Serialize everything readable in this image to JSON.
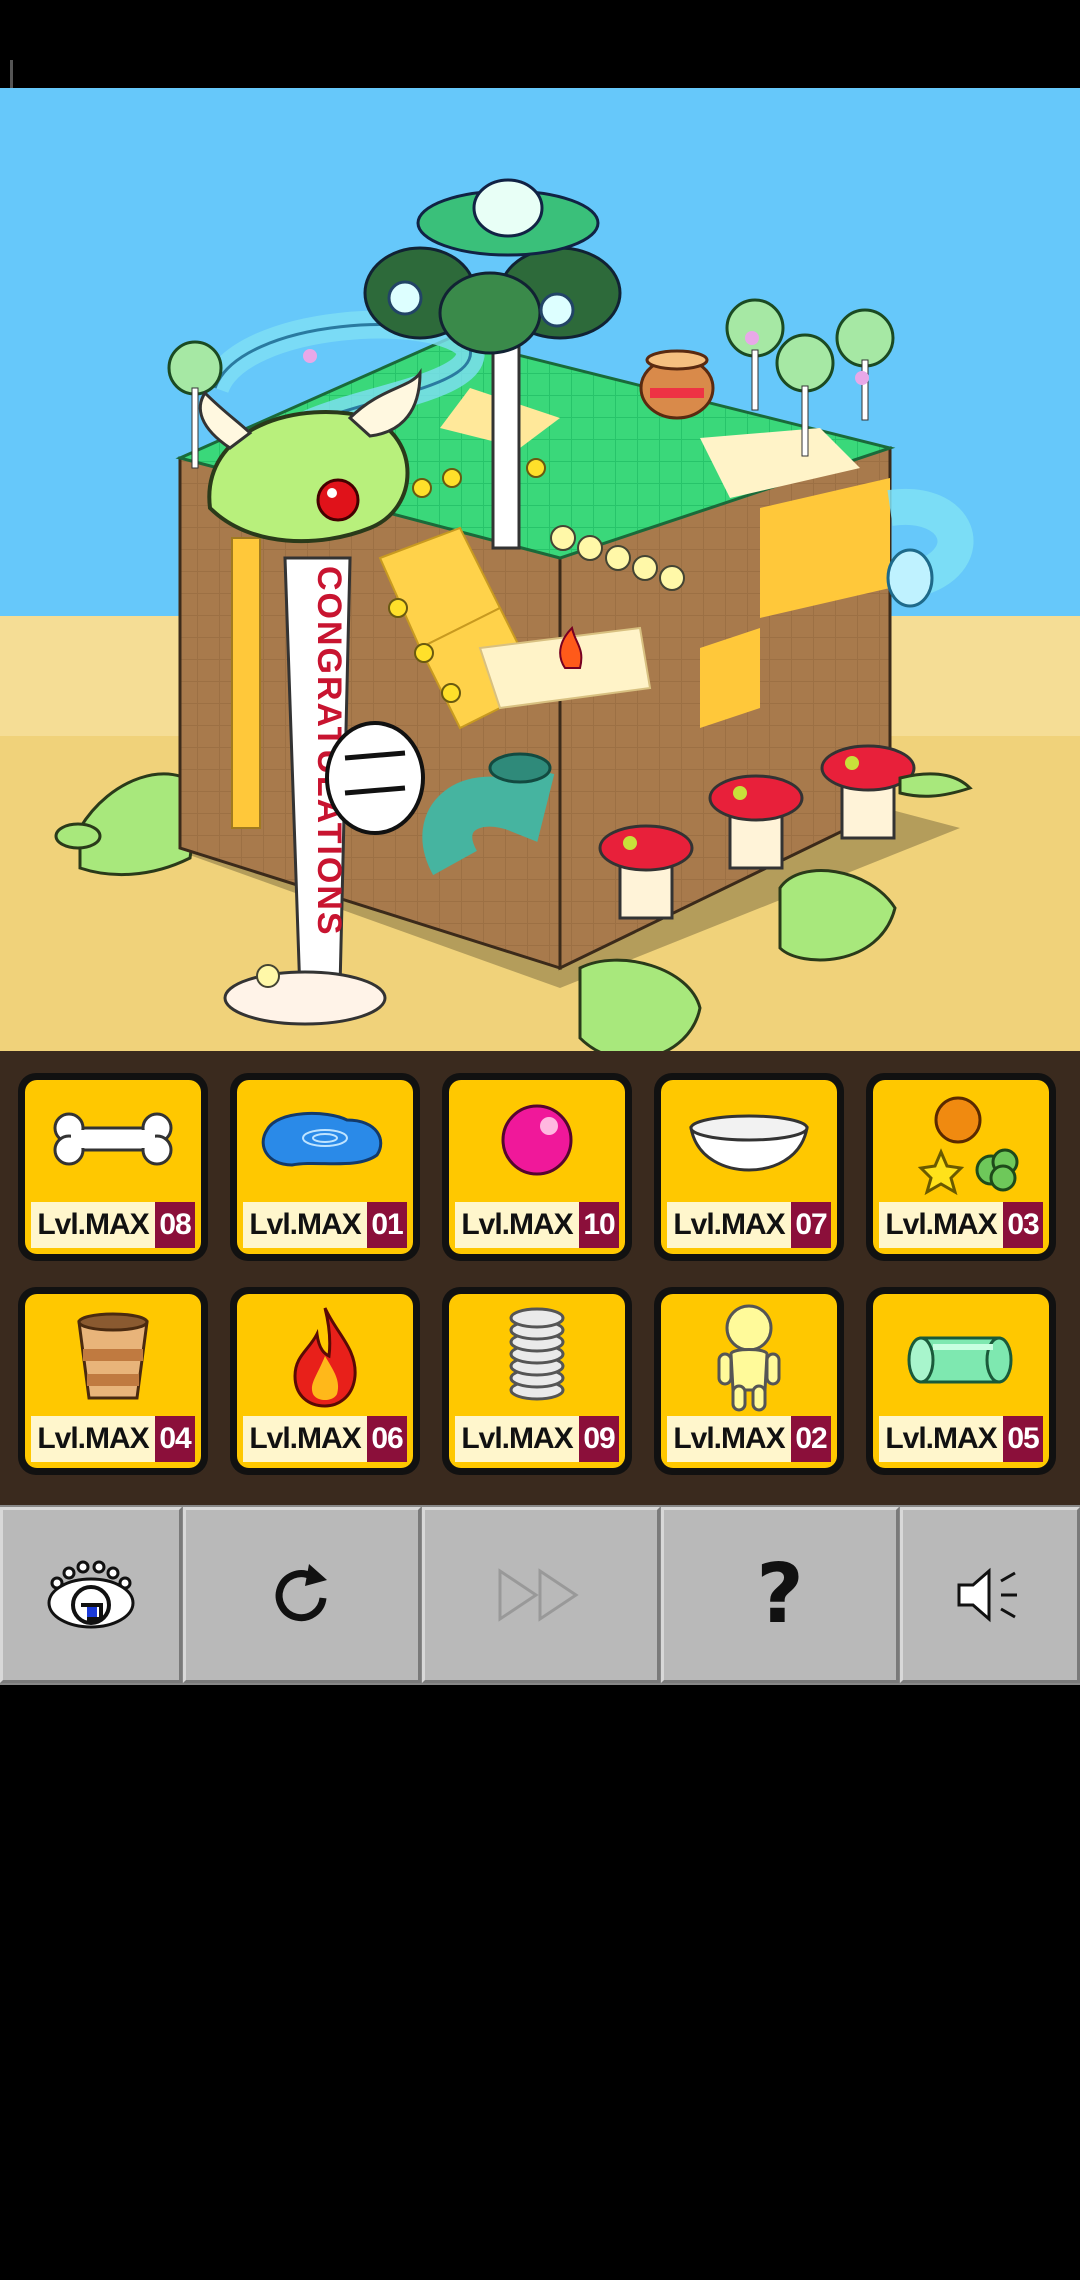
{
  "game": {
    "scene_banner_text": "CONGRATULATIONS",
    "items": [
      {
        "icon": "bone-icon",
        "level": "Lvl.MAX",
        "number": "08"
      },
      {
        "icon": "water-puddle-icon",
        "level": "Lvl.MAX",
        "number": "01"
      },
      {
        "icon": "pink-ball-icon",
        "level": "Lvl.MAX",
        "number": "10"
      },
      {
        "icon": "white-bowl-icon",
        "level": "Lvl.MAX",
        "number": "07"
      },
      {
        "icon": "fruits-icon",
        "level": "Lvl.MAX",
        "number": "03"
      },
      {
        "icon": "wooden-bucket-icon",
        "level": "Lvl.MAX",
        "number": "04"
      },
      {
        "icon": "fire-icon",
        "level": "Lvl.MAX",
        "number": "06"
      },
      {
        "icon": "spring-icon",
        "level": "Lvl.MAX",
        "number": "09"
      },
      {
        "icon": "little-person-icon",
        "level": "Lvl.MAX",
        "number": "02"
      },
      {
        "icon": "glass-tube-icon",
        "level": "Lvl.MAX",
        "number": "05"
      }
    ],
    "toolbar": [
      {
        "icon": "eye-logo-icon",
        "enabled": true
      },
      {
        "icon": "restart-icon",
        "enabled": true
      },
      {
        "icon": "fast-forward-icon",
        "enabled": false
      },
      {
        "icon": "help-question-icon",
        "label": "?",
        "enabled": true
      },
      {
        "icon": "speaker-icon",
        "enabled": true
      }
    ]
  },
  "colors": {
    "sky": "#66c8fa",
    "sand": "#f0d27a",
    "tray": "#3a2a1e",
    "card": "#ffc800",
    "number_badge": "#8b0f3a",
    "toolbar_button": "#b9b9b9"
  }
}
